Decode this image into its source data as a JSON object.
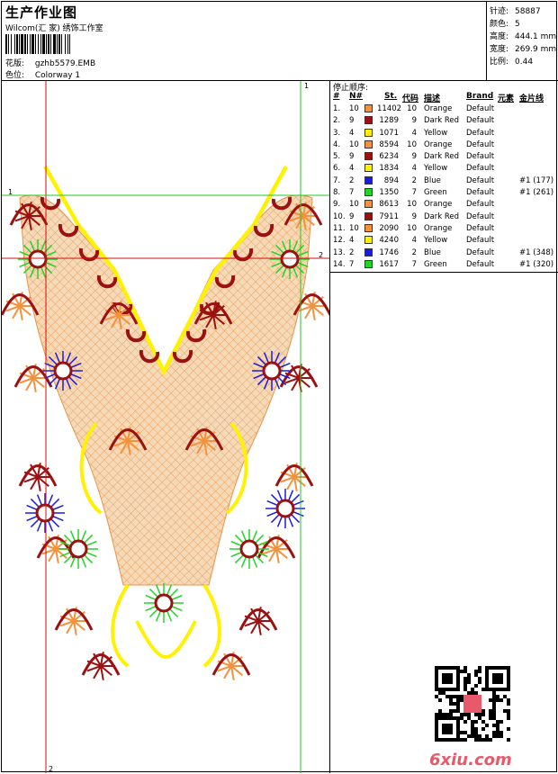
{
  "header": {
    "title": "生产作业图",
    "subtitle": "Wilcom(汇 家) 绣饰工作室",
    "pattern_label": "花版:",
    "pattern_value": "gzhb5579.EMB",
    "colorway_label": "色位:",
    "colorway_value": "Colorway 1"
  },
  "stats": {
    "stitches_label": "针迹:",
    "stitches_value": "58887",
    "colors_label": "颜色:",
    "colors_value": "5",
    "height_label": "高度:",
    "height_value": "444.1 mm",
    "width_label": "宽度:",
    "width_value": "269.9 mm",
    "scale_label": "比例:",
    "scale_value": "0.44"
  },
  "design": {
    "guide_labels": [
      "1",
      "2",
      "1",
      "2"
    ]
  },
  "table": {
    "title": "停止顺序:",
    "columns": [
      "#",
      "N#",
      "St.",
      "代码",
      "描述",
      "Brand",
      "元素",
      "金片线"
    ],
    "rows": [
      {
        "idx": "1.",
        "n": "10",
        "color": "#F4913C",
        "st": "11402",
        "code": "10",
        "desc": "Orange",
        "brand": "Default",
        "elem": "",
        "seq": ""
      },
      {
        "idx": "2.",
        "n": "9",
        "color": "#9B1111",
        "st": "1289",
        "code": "9",
        "desc": "Dark Red",
        "brand": "Default",
        "elem": "",
        "seq": ""
      },
      {
        "idx": "3.",
        "n": "4",
        "color": "#FFF200",
        "st": "1071",
        "code": "4",
        "desc": "Yellow",
        "brand": "Default",
        "elem": "",
        "seq": ""
      },
      {
        "idx": "4.",
        "n": "10",
        "color": "#F4913C",
        "st": "8594",
        "code": "10",
        "desc": "Orange",
        "brand": "Default",
        "elem": "",
        "seq": ""
      },
      {
        "idx": "5.",
        "n": "9",
        "color": "#9B1111",
        "st": "6234",
        "code": "9",
        "desc": "Dark Red",
        "brand": "Default",
        "elem": "",
        "seq": ""
      },
      {
        "idx": "6.",
        "n": "4",
        "color": "#FFF200",
        "st": "1834",
        "code": "4",
        "desc": "Yellow",
        "brand": "Default",
        "elem": "",
        "seq": ""
      },
      {
        "idx": "7.",
        "n": "2",
        "color": "#1C1CE0",
        "st": "894",
        "code": "2",
        "desc": "Blue",
        "brand": "Default",
        "elem": "",
        "seq": "#1 (177)"
      },
      {
        "idx": "8.",
        "n": "7",
        "color": "#22D42A",
        "st": "1350",
        "code": "7",
        "desc": "Green",
        "brand": "Default",
        "elem": "",
        "seq": "#1 (261)"
      },
      {
        "idx": "9.",
        "n": "10",
        "color": "#F4913C",
        "st": "8613",
        "code": "10",
        "desc": "Orange",
        "brand": "Default",
        "elem": "",
        "seq": ""
      },
      {
        "idx": "10.",
        "n": "9",
        "color": "#9B1111",
        "st": "7911",
        "code": "9",
        "desc": "Dark Red",
        "brand": "Default",
        "elem": "",
        "seq": ""
      },
      {
        "idx": "11.",
        "n": "10",
        "color": "#F4913C",
        "st": "2090",
        "code": "10",
        "desc": "Orange",
        "brand": "Default",
        "elem": "",
        "seq": ""
      },
      {
        "idx": "12.",
        "n": "4",
        "color": "#FFF200",
        "st": "4240",
        "code": "4",
        "desc": "Yellow",
        "brand": "Default",
        "elem": "",
        "seq": ""
      },
      {
        "idx": "13.",
        "n": "2",
        "color": "#1C1CE0",
        "st": "1746",
        "code": "2",
        "desc": "Blue",
        "brand": "Default",
        "elem": "",
        "seq": "#1 (348)"
      },
      {
        "idx": "14.",
        "n": "7",
        "color": "#22D42A",
        "st": "1617",
        "code": "7",
        "desc": "Green",
        "brand": "Default",
        "elem": "",
        "seq": "#1 (320)"
      }
    ]
  },
  "watermark": {
    "text": "6xiu.com",
    "icon": "qr-code-icon"
  },
  "colors": {
    "orange": "#F4913C",
    "dark_red": "#9B1111",
    "yellow": "#FFF200",
    "blue": "#1C1CE0",
    "green": "#22D42A",
    "guide_red": "#D01010",
    "guide_green": "#22C922"
  }
}
